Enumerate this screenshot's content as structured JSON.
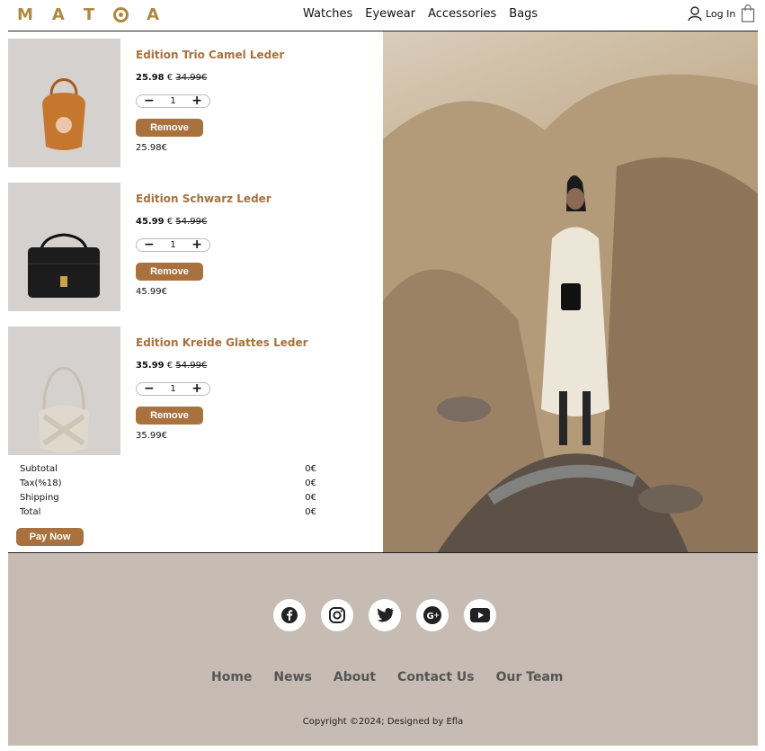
{
  "header": {
    "logo_letters": [
      "M",
      "A",
      "T",
      "O",
      "A"
    ],
    "nav": [
      "Watches",
      "Eyewear",
      "Accessories",
      "Bags"
    ],
    "login_label": "Log In"
  },
  "cart": {
    "currency_sep": "€",
    "items": [
      {
        "name": "Edition Trio Camel Leder",
        "price": "25.98",
        "old_price": "34.99€",
        "qty": "1",
        "remove_label": "Remove",
        "line_total": "25.98€",
        "bag_color": "#c6772f"
      },
      {
        "name": "Edition Schwarz Leder",
        "price": "45.99",
        "old_price": "54.99€",
        "qty": "1",
        "remove_label": "Remove",
        "line_total": "45.99€",
        "bag_color": "#1c1c1c"
      },
      {
        "name": "Edition Kreide Glattes Leder",
        "price": "35.99",
        "old_price": "54.99€",
        "qty": "1",
        "remove_label": "Remove",
        "line_total": "35.99€",
        "bag_color": "#dcd3c7"
      }
    ],
    "summary": [
      {
        "label": "Subtotal",
        "value": "0€"
      },
      {
        "label": "Tax(%18)",
        "value": "0€"
      },
      {
        "label": "Shipping",
        "value": "0€"
      },
      {
        "label": "Total",
        "value": "0€"
      }
    ],
    "pay_label": "Pay Now"
  },
  "footer": {
    "social_icons": [
      "facebook-icon",
      "instagram-icon",
      "twitter-icon",
      "google-plus-icon",
      "youtube-icon"
    ],
    "links": [
      "Home",
      "News",
      "About",
      "Contact Us",
      "Our Team"
    ],
    "copyright": "Copyright ©2024; Designed by Efla"
  },
  "colors": {
    "accent": "#a8713e",
    "logo": "#b0883f",
    "footer_bg": "#c6bcb3"
  }
}
